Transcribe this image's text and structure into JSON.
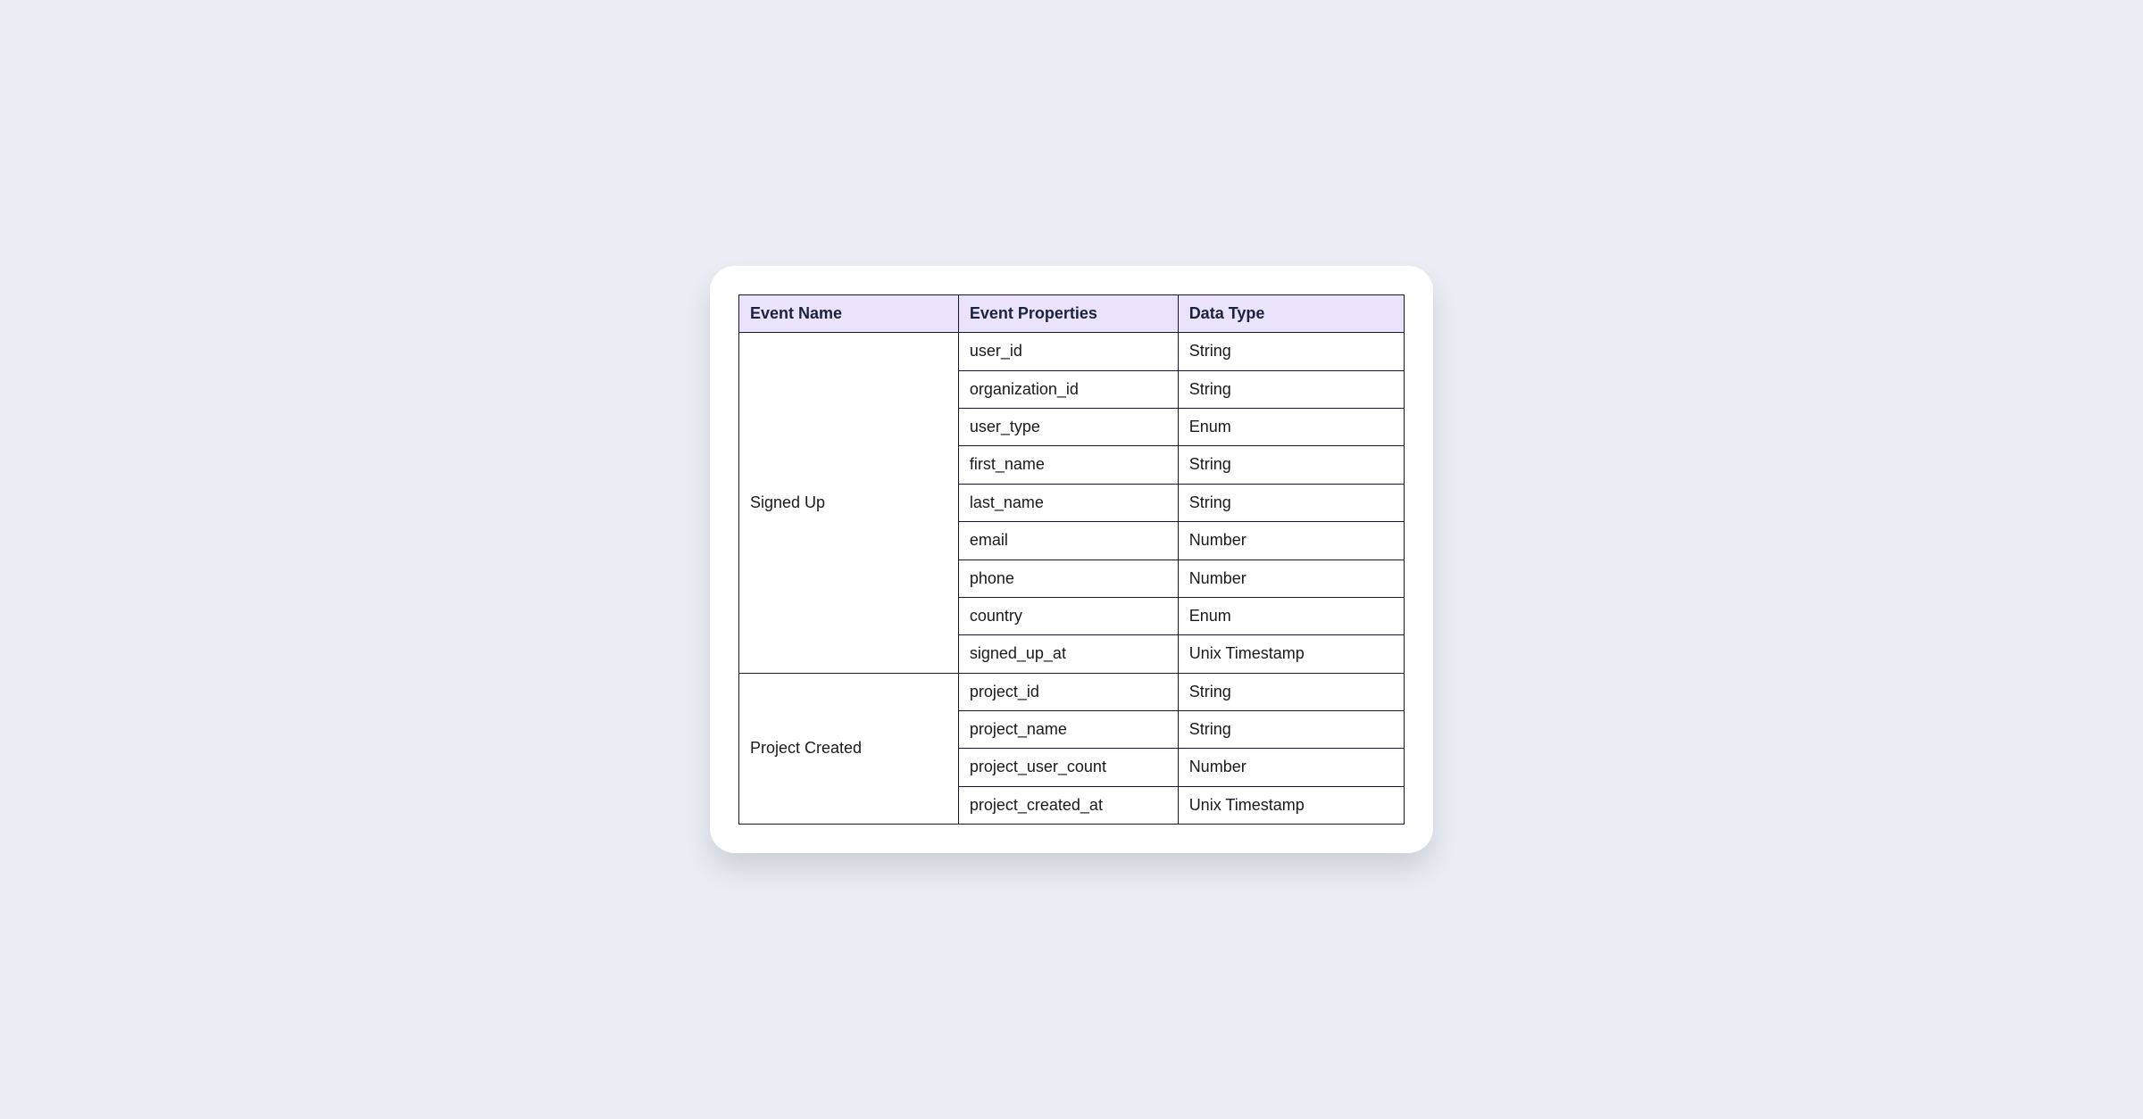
{
  "table": {
    "headers": {
      "event_name": "Event Name",
      "event_properties": "Event Properties",
      "data_type": "Data Type"
    },
    "events": [
      {
        "name": "Signed Up",
        "properties": [
          {
            "name": "user_id",
            "type": "String"
          },
          {
            "name": "organization_id",
            "type": "String"
          },
          {
            "name": "user_type",
            "type": "Enum"
          },
          {
            "name": "first_name",
            "type": "String"
          },
          {
            "name": "last_name",
            "type": "String"
          },
          {
            "name": "email",
            "type": "Number"
          },
          {
            "name": "phone",
            "type": "Number"
          },
          {
            "name": "country",
            "type": "Enum"
          },
          {
            "name": "signed_up_at",
            "type": "Unix Timestamp"
          }
        ]
      },
      {
        "name": "Project Created",
        "properties": [
          {
            "name": "project_id",
            "type": "String"
          },
          {
            "name": "project_name",
            "type": "String"
          },
          {
            "name": "project_user_count",
            "type": "Number"
          },
          {
            "name": "project_created_at",
            "type": "Unix Timestamp"
          }
        ]
      }
    ]
  }
}
